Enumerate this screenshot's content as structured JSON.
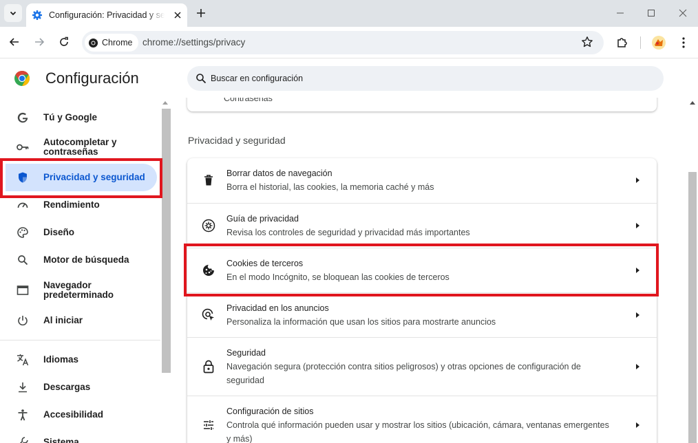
{
  "browser": {
    "tab_title": "Configuración: Privacidad y seguridad",
    "chip_label": "Chrome",
    "url": "chrome://settings/privacy"
  },
  "header": {
    "app_title": "Configuración",
    "search_placeholder": "Buscar en configuración"
  },
  "sidebar": {
    "items": [
      {
        "label": "Tú y Google",
        "icon": "google-icon"
      },
      {
        "label": "Autocompletar y contraseñas",
        "icon": "key-icon"
      },
      {
        "label": "Privacidad y seguridad",
        "icon": "shield-icon",
        "active": true
      },
      {
        "label": "Rendimiento",
        "icon": "speedometer-icon"
      },
      {
        "label": "Diseño",
        "icon": "palette-icon"
      },
      {
        "label": "Motor de búsqueda",
        "icon": "search-icon"
      },
      {
        "label": "Navegador predeterminado",
        "icon": "browser-window-icon"
      },
      {
        "label": "Al iniciar",
        "icon": "power-icon"
      },
      {
        "label": "Idiomas",
        "icon": "translate-icon"
      },
      {
        "label": "Descargas",
        "icon": "download-icon"
      },
      {
        "label": "Accesibilidad",
        "icon": "accessibility-icon"
      },
      {
        "label": "Sistema",
        "icon": "wrench-icon"
      }
    ]
  },
  "main": {
    "prev_card_text": "Contraseñas",
    "section_title": "Privacidad y seguridad",
    "rows": [
      {
        "title": "Borrar datos de navegación",
        "subtitle": "Borra el historial, las cookies, la memoria caché y más",
        "icon": "trash-icon"
      },
      {
        "title": "Guía de privacidad",
        "subtitle": "Revisa los controles de seguridad y privacidad más importantes",
        "icon": "privacy-guide-icon"
      },
      {
        "title": "Cookies de terceros",
        "subtitle": "En el modo Incógnito, se bloquean las cookies de terceros",
        "icon": "cookie-icon"
      },
      {
        "title": "Privacidad en los anuncios",
        "subtitle": "Personaliza la información que usan los sitios para mostrarte anuncios",
        "icon": "ad-privacy-icon"
      },
      {
        "title": "Seguridad",
        "subtitle": "Navegación segura (protección contra sitios peligrosos) y otras opciones de configuración de seguridad",
        "icon": "lock-icon"
      },
      {
        "title": "Configuración de sitios",
        "subtitle": "Controla qué información pueden usar y mostrar los sitios (ubicación, cámara, ventanas emergentes y más)",
        "icon": "tune-icon"
      }
    ]
  },
  "colors": {
    "highlight": "#e0161e",
    "active_bg": "#d3e3fd",
    "active_text": "#0b57d0"
  }
}
